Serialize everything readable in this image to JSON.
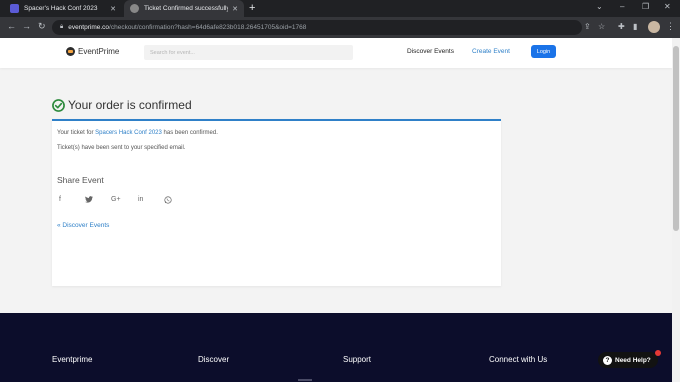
{
  "browser": {
    "tabs": [
      {
        "title": "Spacer's Hack Conf 2023",
        "favicon_color": "#5b5bd6",
        "active": false
      },
      {
        "title": "Ticket Confirmed successfully | E",
        "favicon_color": "#888888",
        "active": true
      }
    ],
    "new_tab": "+",
    "window_controls": {
      "collapse": "⌄",
      "minimize": "–",
      "maximize": "❐",
      "close": "✕"
    },
    "nav": {
      "back": "←",
      "forward": "→",
      "reload": "↻"
    },
    "address": {
      "domain": "eventprime.co",
      "path": "/checkout/confirmation?hash=64d6afe823b018.26451705&oid=1768"
    },
    "toolbar_icons": [
      "share-icon",
      "star-icon",
      "extensions-icon",
      "sidebar-icon"
    ],
    "menu": "⋮"
  },
  "site_header": {
    "logo_text": "EventPrime",
    "search_placeholder": "Search for event...",
    "discover_events": "Discover Events",
    "create_event": "Create Event",
    "login": "Login"
  },
  "confirmation": {
    "heading": "Your order is confirmed",
    "line1_prefix": "Your ticket for",
    "event_name": "Spacers Hack Conf 2023",
    "line1_suffix": "has been confirmed.",
    "line2": "Ticket(s) have been sent to your specified email.",
    "share_title": "Share Event",
    "social_icons": [
      "facebook-icon",
      "twitter-icon",
      "google-plus-icon",
      "linkedin-icon",
      "whatsapp-icon"
    ],
    "discover_link": "« Discover Events"
  },
  "footer": {
    "columns": [
      "Eventprime",
      "Discover",
      "Support",
      "Connect with Us"
    ],
    "help_label": "Need Help?"
  },
  "colors": {
    "accent": "#2f80c8",
    "success": "#2e8b3e",
    "footer_bg": "#0c0d2b",
    "login_bg": "#1a73e8"
  }
}
